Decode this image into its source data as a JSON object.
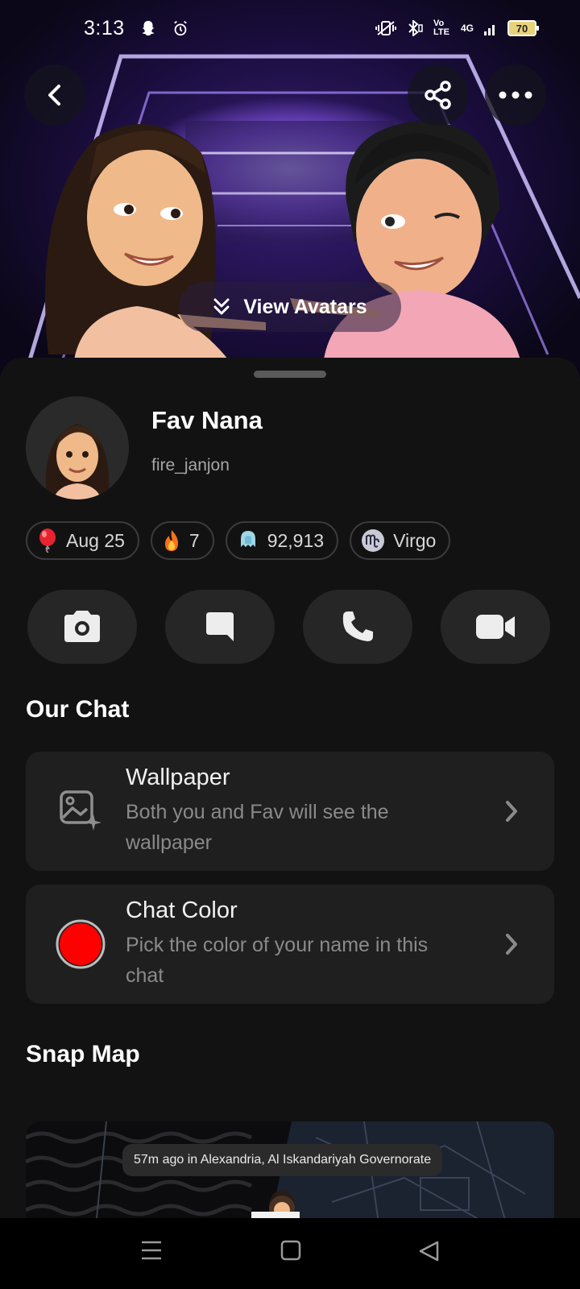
{
  "status_bar": {
    "time": "3:13",
    "left_icons": [
      "snapchat-ghost-icon",
      "alarm-icon"
    ],
    "right_icons": [
      "vibrate-icon",
      "bluetooth-icon",
      "volte-icon",
      "signal-4g-icon"
    ],
    "network_label": "4G",
    "volte_label": "Vo LTE",
    "battery": "70"
  },
  "hero": {
    "view_avatars_label": "View Avatars"
  },
  "profile": {
    "name": "Fav Nana",
    "username": "fire_janjon"
  },
  "pills": [
    {
      "icon": "balloon-icon",
      "label": "Aug 25"
    },
    {
      "icon": "fire-icon",
      "label": "7"
    },
    {
      "icon": "ghost-score-icon",
      "label": "92,913"
    },
    {
      "icon": "virgo-icon",
      "label": "Virgo"
    }
  ],
  "actions": [
    {
      "icon": "camera-icon"
    },
    {
      "icon": "chat-icon"
    },
    {
      "icon": "phone-icon"
    },
    {
      "icon": "video-icon"
    }
  ],
  "our_chat": {
    "title": "Our Chat",
    "wallpaper": {
      "title": "Wallpaper",
      "description": "Both you and Fav will see the wallpaper"
    },
    "chat_color": {
      "title": "Chat Color",
      "description": "Pick the color of your name in this chat",
      "color": "#ff0000"
    }
  },
  "snap_map": {
    "title": "Snap Map",
    "location_text": "57m ago in Alexandria, Al Iskandariyah Governorate"
  },
  "colors": {
    "background": "#121212",
    "card": "#1f1f1f",
    "action_button": "#262626"
  }
}
